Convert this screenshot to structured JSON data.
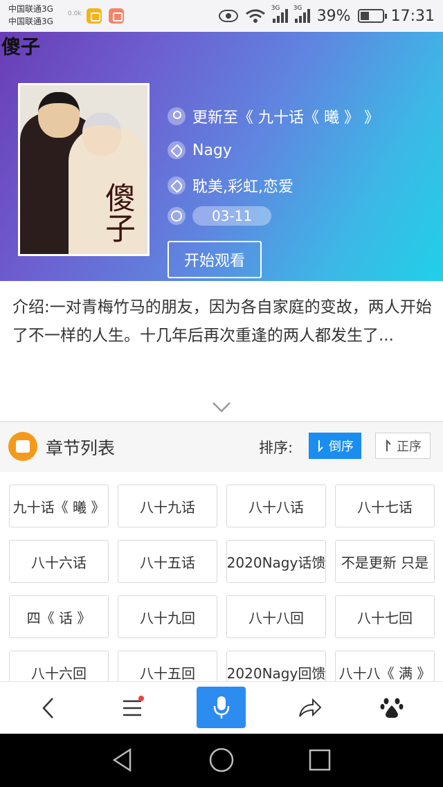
{
  "status_bar": {
    "carrier_1": "中国联通3G",
    "carrier_2": "中国联通3G",
    "net_tiny": "0.0k",
    "signal_1_label": "3G",
    "signal_2_label": "3G",
    "battery": "39%",
    "time": "17:31",
    "icons": [
      "eye-icon",
      "wifi-icon",
      "signal-icon",
      "battery-icon"
    ]
  },
  "hero": {
    "page_title": "傻子",
    "cover_title": "傻子",
    "update": "更新至《 九十话《 曦 》 》",
    "author": "Nagy",
    "tags": "耽美,彩虹,恋爱",
    "date": "03-11",
    "start_button": "开始观看",
    "gradient_colors": [
      "#6a3db6",
      "#5f86e0",
      "#20d0e8"
    ]
  },
  "intro": {
    "text": "介绍:一对青梅竹马的朋友，因为各自家庭的变故，两人开始了不一样的人生。十几年后再次重逢的两人都发生了..."
  },
  "chapters": {
    "title": "章节列表",
    "sort_label": "排序:",
    "sort_desc": "倒序",
    "sort_asc": "正序",
    "active_sort": "desc",
    "accent": "#1a8df0",
    "items": [
      "九十话《 曦 》",
      "八十九话",
      "八十八话",
      "八十七话",
      "八十六话",
      "八十五话",
      "2020Nagy话馈",
      "不是更新 只是",
      "四《 话 》",
      "八十九回",
      "八十八回",
      "八十七回",
      "八十六回",
      "八十五回",
      "2020Nagy回馈",
      "八十八《 满 》"
    ]
  },
  "toolbar": {
    "items": [
      "back-icon",
      "menu-icon",
      "microphone-icon",
      "share-icon",
      "baidu-paw-icon"
    ],
    "accent": "#2d8cf0"
  },
  "navbar": {
    "items": [
      "back-triangle-icon",
      "home-circle-icon",
      "recents-square-icon"
    ]
  }
}
